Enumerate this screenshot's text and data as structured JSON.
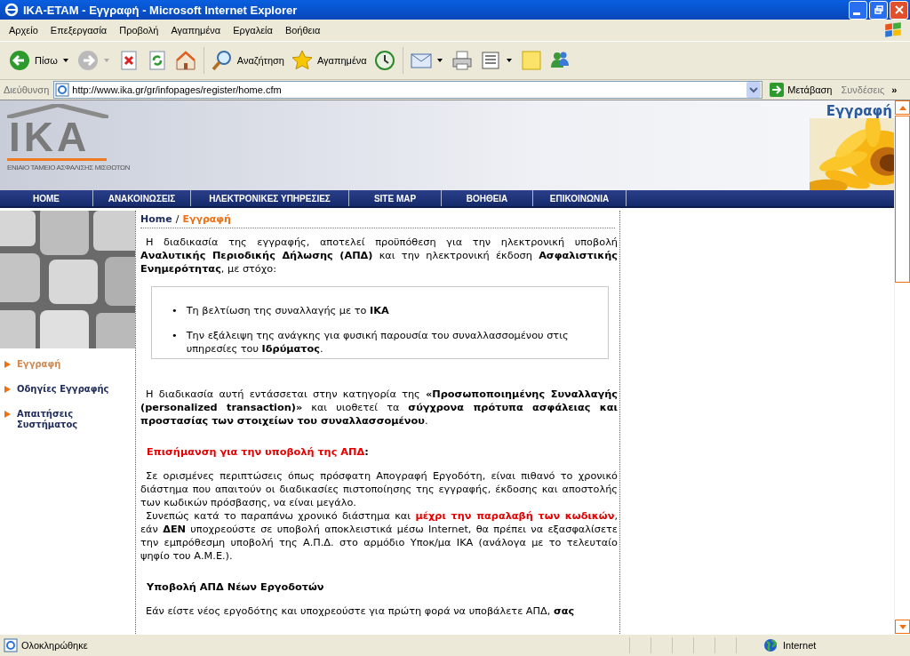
{
  "window": {
    "title": "IKA-ETAM - Εγγραφή - Microsoft Internet Explorer"
  },
  "menu": [
    "Αρχείο",
    "Επεξεργασία",
    "Προβολή",
    "Αγαπημένα",
    "Εργαλεία",
    "Βοήθεια"
  ],
  "toolbar": [
    {
      "kind": "back",
      "label": "Πίσω",
      "dropdown": true
    },
    {
      "kind": "forward",
      "dropdown": true
    },
    {
      "kind": "stop"
    },
    {
      "kind": "refresh"
    },
    {
      "kind": "home"
    },
    {
      "kind": "search",
      "label": "Αναζήτηση"
    },
    {
      "kind": "favorites",
      "label": "Αγαπημένα"
    },
    {
      "kind": "history"
    },
    {
      "kind": "mail",
      "dropdown": true
    },
    {
      "kind": "print"
    },
    {
      "kind": "edit",
      "dropdown": true
    },
    {
      "kind": "note"
    },
    {
      "kind": "messenger"
    }
  ],
  "address": {
    "label": "Διεύθυνση",
    "value": "http://www.ika.gr/gr/infopages/register/home.cfm",
    "go": "Μετάβαση",
    "links": "Συνδέσεις",
    "more": "»"
  },
  "site": {
    "logo": "ΙΚΑ",
    "logo_caption": "ΕΝΙΑΙΟ ΤΑΜΕΙΟ ΑΣΦΑΛΙΣΗΣ ΜΙΣΘΩΤΩΝ",
    "page_title": "Εγγραφή",
    "nav": [
      "HOME",
      "ΑΝΑΚΟΙΝΩΣΕΙΣ",
      "ΗΛΕΚΤΡΟΝΙΚΕΣ ΥΠΗΡΕΣΙΕΣ",
      "SITE MAP",
      "ΒΟΗΘΕΙΑ",
      "ΕΠΙΚΟΙΝΩΝΙΑ"
    ],
    "sidebar": [
      {
        "label": "Εγγραφή",
        "selected": true
      },
      {
        "label": "Οδηγίες Εγγραφής",
        "selected": false
      },
      {
        "label": "Απαιτήσεις Συστήματος",
        "selected": false
      }
    ],
    "breadcrumb": {
      "home": "Home",
      "separator": "/",
      "current": "Εγγραφή"
    },
    "content": [
      {
        "kind": "paragraph",
        "segments": [
          {
            "kind": "plain",
            "text": "Η διαδικασία της εγγραφής, αποτελεί προϋπόθεση για την ηλεκτρονική υποβολή "
          },
          {
            "kind": "bold",
            "text": "Αναλυτικής Περιοδικής Δήλωσης (ΑΠΔ)"
          },
          {
            "kind": "plain",
            "text": " και την ηλεκτρονική έκδοση "
          },
          {
            "kind": "bold",
            "text": "Ασφαλιστικής Ενημερότητας"
          },
          {
            "kind": "plain",
            "text": ", με στόχο:"
          }
        ]
      },
      {
        "kind": "list",
        "marker": "•",
        "items": [
          [
            {
              "kind": "plain",
              "text": "Τη βελτίωση της συναλλαγής με το "
            },
            {
              "kind": "bold",
              "text": "ΙΚΑ"
            }
          ],
          [
            {
              "kind": "plain",
              "text": "Την εξάλειψη της ανάγκης για φυσική παρουσία του συναλλασσομένου στις υπηρεσίες του "
            },
            {
              "kind": "bold",
              "text": "Ιδρύματος"
            },
            {
              "kind": "plain",
              "text": "."
            }
          ]
        ]
      },
      {
        "kind": "paragraph",
        "segments": [
          {
            "kind": "plain",
            "text": "Η διαδικασία αυτή εντάσσεται στην κατηγορία της "
          },
          {
            "kind": "bold",
            "text": "«Προσωποποιημένης Συναλλαγής (personalized transaction)»"
          },
          {
            "kind": "plain",
            "text": " και υιοθετεί τα "
          },
          {
            "kind": "bold",
            "text": "σύγχρονα πρότυπα ασφάλειας και προστασίας των στοιχείων του συναλλασσομένου"
          },
          {
            "kind": "plain",
            "text": "."
          }
        ]
      },
      {
        "kind": "heading",
        "segments": [
          {
            "kind": "red",
            "text": "Επισήμανση για την υποβολή της ΑΠΔ"
          },
          {
            "kind": "plain",
            "text": ":"
          }
        ]
      },
      {
        "kind": "paragraph",
        "segments": [
          {
            "kind": "plain",
            "text": "Σε ορισμένες περιπτώσεις όπως πρόσφατη Απογραφή Εργοδότη, είναι πιθανό το χρονικό διάστημα που απαιτούν οι διαδικασίες πιστοποίησης της εγγραφής, έκδοσης και αποστολής των κωδικών πρόσβασης, να είναι μεγάλο."
          }
        ]
      },
      {
        "kind": "continued",
        "segments": [
          {
            "kind": "plain",
            "text": "Συνεπώς κατά το παραπάνω χρονικό διάστημα και "
          },
          {
            "kind": "red",
            "text": "μέχρι την παραλαβή των κωδικών"
          },
          {
            "kind": "plain",
            "text": ", εάν "
          },
          {
            "kind": "bold",
            "text": "ΔΕΝ"
          },
          {
            "kind": "plain",
            "text": " υποχρεούστε σε υποβολή αποκλειστικά μέσω Internet, θα πρέπει να εξασφαλίσετε την εμπρόθεσμη υποβολή της Α.Π.Δ. στο αρμόδιο Υποκ/μα ΙΚΑ (ανάλογα με το τελευταίο ψηφίο του Α.Μ.Ε.)."
          }
        ]
      },
      {
        "kind": "heading",
        "segments": [
          {
            "kind": "bold",
            "text": "Υποβολή ΑΠΔ Νέων Εργοδοτών"
          }
        ]
      },
      {
        "kind": "paragraph",
        "segments": [
          {
            "kind": "plain",
            "text": "Εάν είστε νέος εργοδότης και υποχρεούστε για πρώτη φορά να υποβάλετε ΑΠΔ, "
          },
          {
            "kind": "bold",
            "text": "σας"
          }
        ]
      }
    ]
  },
  "status_bar": {
    "text": "Ολοκληρώθηκε",
    "zone": "Internet"
  }
}
